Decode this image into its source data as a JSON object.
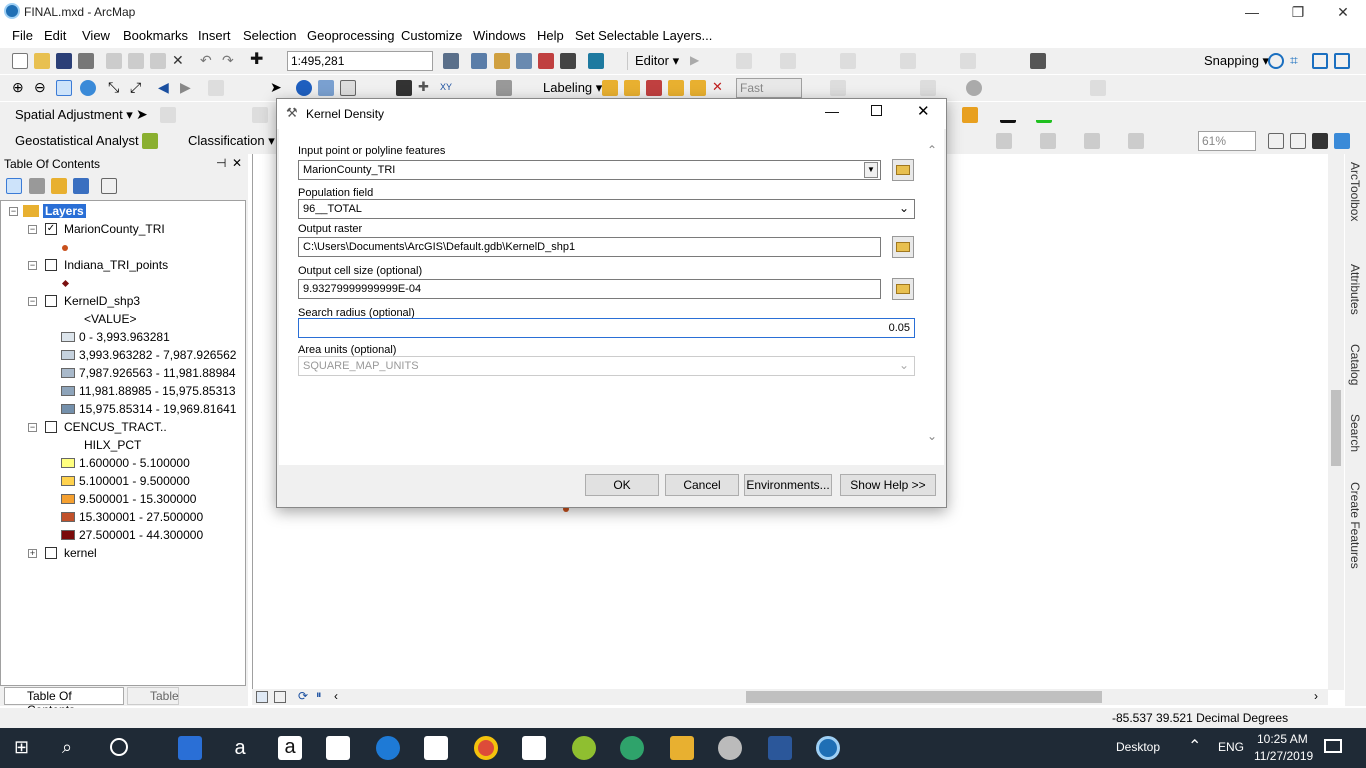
{
  "window": {
    "title": "FINAL.mxd - ArcMap",
    "min": "—",
    "max": "❐",
    "close": "✕"
  },
  "menu": [
    "File",
    "Edit",
    "View",
    "Bookmarks",
    "Insert",
    "Selection",
    "Geoprocessing",
    "Customize",
    "Windows",
    "Help",
    "Set Selectable Layers..."
  ],
  "toolbar": {
    "scale": "1:495,281",
    "editor": "Editor ▾",
    "labeling": "Labeling ▾",
    "fast": "Fast",
    "snapping": "Snapping ▾",
    "spatial_adjustment": "Spatial Adjustment ▾",
    "geostat": "Geostatistical Analyst ▾",
    "classification": "Classification ▾",
    "zoom": "61%"
  },
  "toc": {
    "title": "Table Of Contents",
    "pin": "𝟒",
    "close": "✕",
    "root": "Layers",
    "layers": [
      {
        "name": "MarionCounty_TRI",
        "checked": true
      },
      {
        "name": "Indiana_TRI_points",
        "checked": false
      },
      {
        "name": "KernelD_shp3",
        "checked": false,
        "field": "<VALUE>",
        "classes": [
          "0 - 3,993.963281",
          "3,993.963282 - 7,987.926562",
          "7,987.926563 - 11,981.88984",
          "11,981.88985 - 15,975.85313",
          "15,975.85314 - 19,969.81641"
        ]
      },
      {
        "name": "CENCUS_TRACT..",
        "checked": false,
        "field": "HILX_PCT",
        "classes": [
          "1.600000 - 5.100000",
          "5.100001 - 9.500000",
          "9.500001 - 15.300000",
          "15.300001 - 27.500000",
          "27.500001 - 44.300000"
        ]
      },
      {
        "name": "kernel",
        "checked": false
      }
    ],
    "tabs": [
      "Table Of Contents",
      "Table"
    ]
  },
  "kernel_colors": [
    "#dde5ec",
    "#c6d2de",
    "#a9b9ca",
    "#8ea4ba",
    "#7490ab"
  ],
  "cencus_colors": [
    "#ffff7f",
    "#ffd24d",
    "#f5a030",
    "#c0502a",
    "#7a0b0b"
  ],
  "rightbar": [
    "ArcToolbox",
    "Attributes",
    "Catalog",
    "Search",
    "Create Features"
  ],
  "dialog": {
    "title": "Kernel Density",
    "input_label": "Input point or polyline features",
    "input_value": "MarionCounty_TRI",
    "pop_label": "Population field",
    "pop_value": "96__TOTAL",
    "out_label": "Output raster",
    "out_value": "C:\\Users\\Documents\\ArcGIS\\Default.gdb\\KernelD_shp1",
    "cell_label": "Output cell size (optional)",
    "cell_value": "9.93279999999999E-04",
    "radius_label": "Search radius (optional)",
    "radius_value": "0.05",
    "area_label": "Area units (optional)",
    "area_value": "SQUARE_MAP_UNITS",
    "ok": "OK",
    "cancel": "Cancel",
    "env": "Environments...",
    "help": "Show Help >>"
  },
  "status": {
    "coords": "-85.537  39.521 Decimal Degrees"
  },
  "taskbar": {
    "desktop": "Desktop",
    "lang": "ENG",
    "time": "10:25 AM",
    "date": "11/27/2019"
  }
}
